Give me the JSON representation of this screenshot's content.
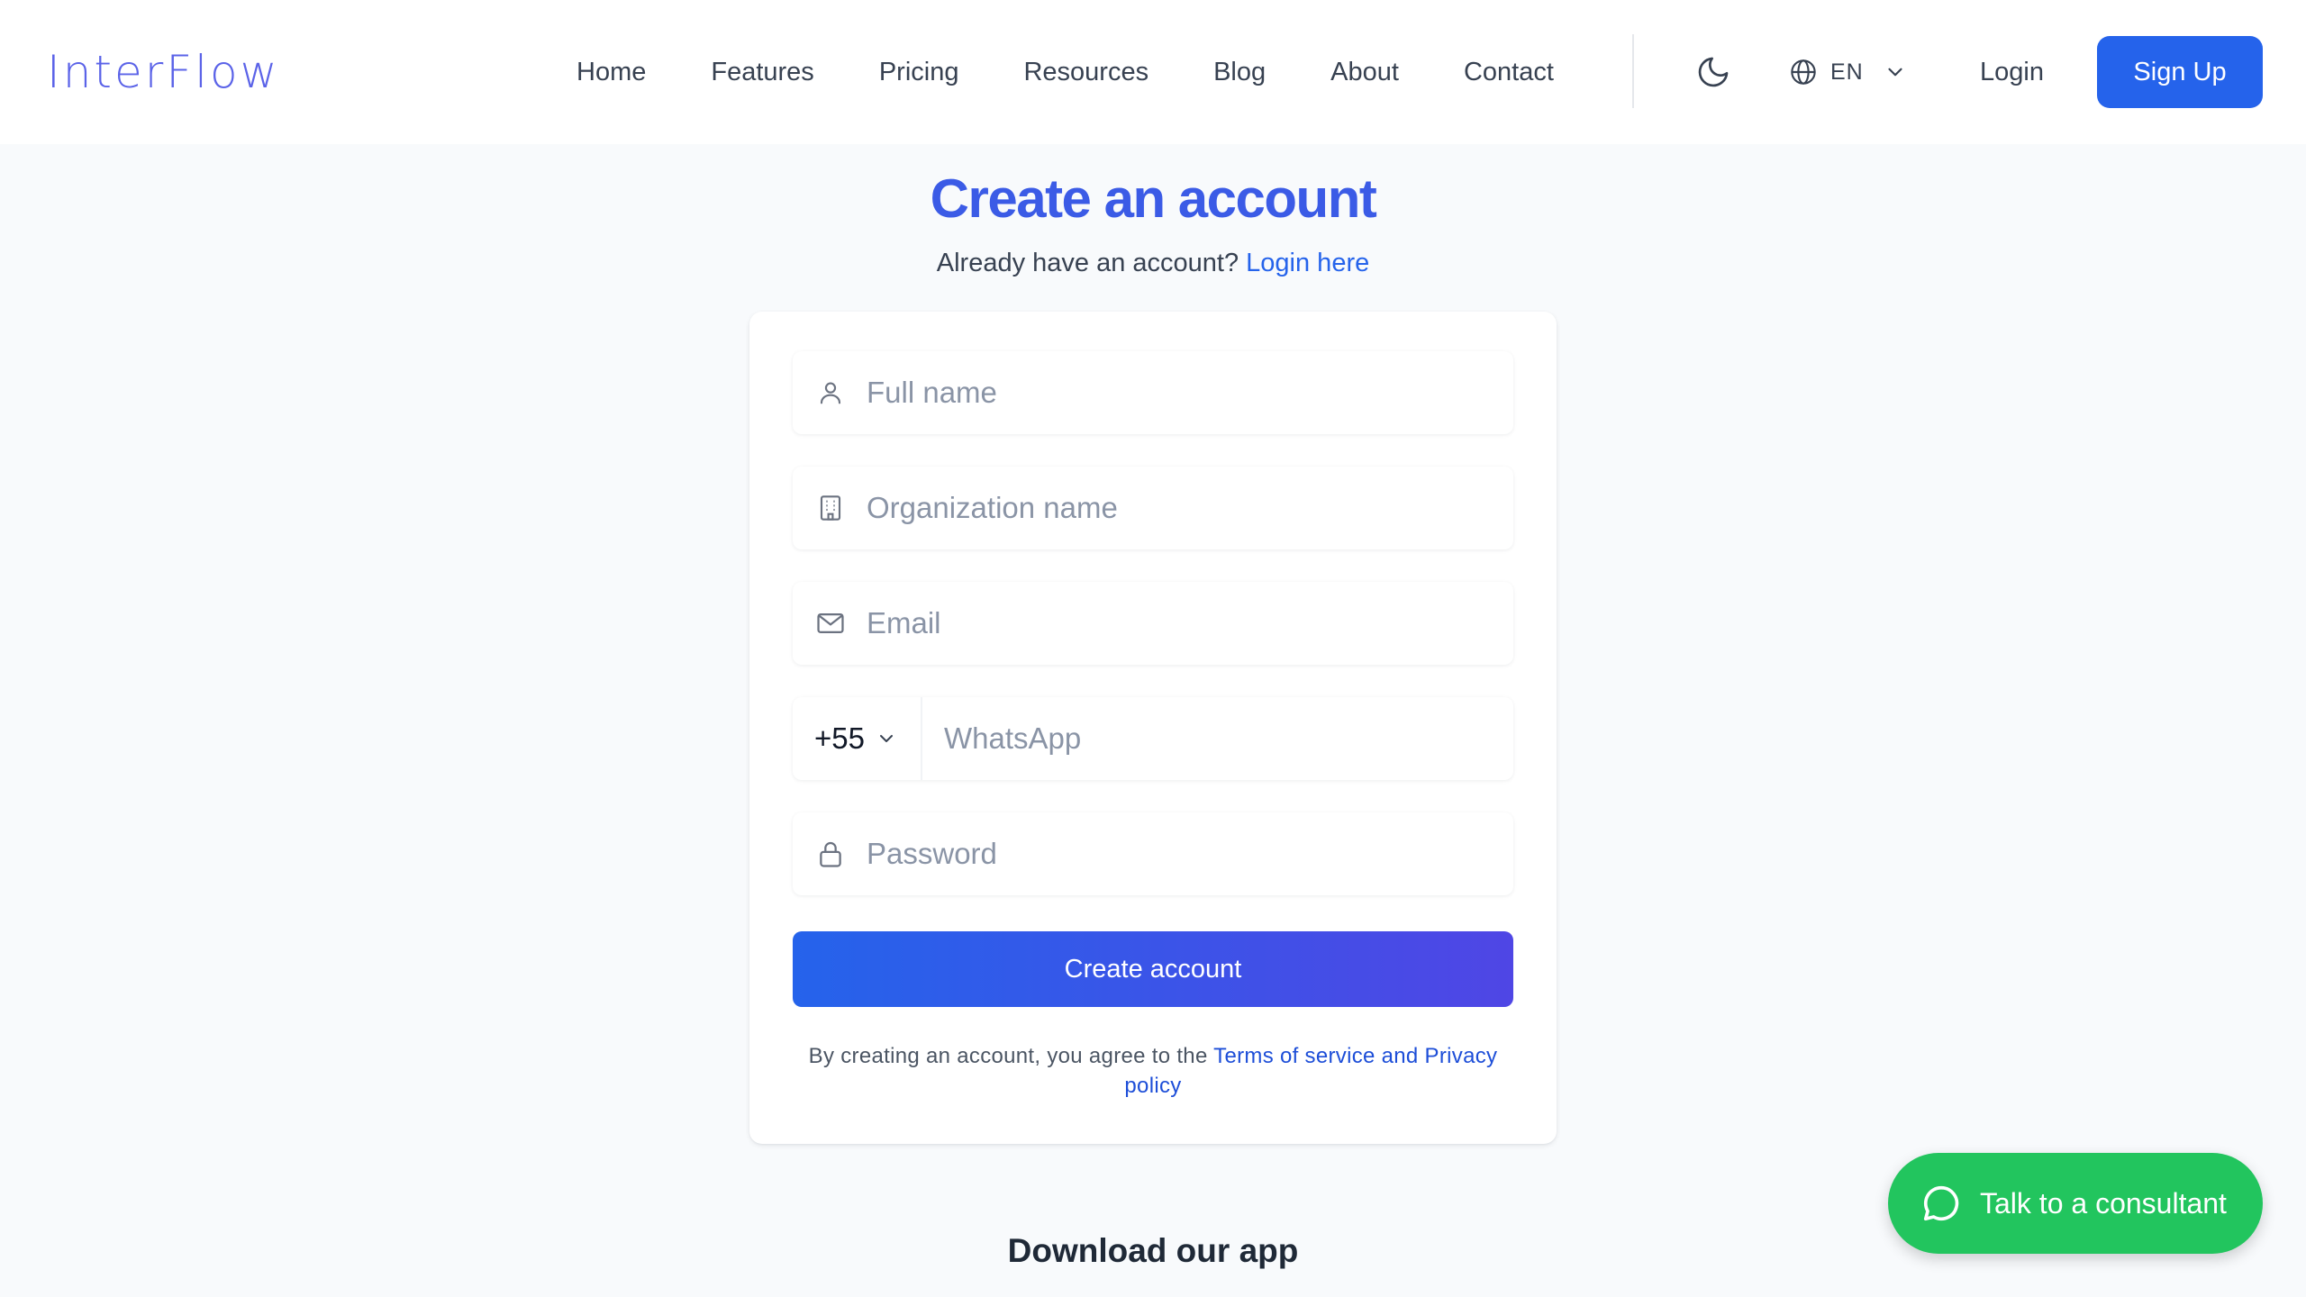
{
  "header": {
    "logo_text": "InterFlow",
    "nav": [
      "Home",
      "Features",
      "Pricing",
      "Resources",
      "Blog",
      "About",
      "Contact"
    ],
    "language": "EN",
    "login_label": "Login",
    "signup_label": "Sign Up"
  },
  "page": {
    "title": "Create an account",
    "subtitle_prefix": "Already have an account?",
    "subtitle_link": "Login here"
  },
  "form": {
    "full_name_placeholder": "Full name",
    "organization_placeholder": "Organization name",
    "email_placeholder": "Email",
    "country_code": "+55",
    "whatsapp_placeholder": "WhatsApp",
    "password_placeholder": "Password",
    "submit_label": "Create account",
    "terms_prefix": "By creating an account, you agree to the",
    "terms_link": "Terms of service and Privacy policy"
  },
  "download_title": "Download our app",
  "consultant_label": "Talk to a consultant",
  "icons": {
    "theme": "moon-icon",
    "language": "globe-icon",
    "full_name": "user-icon",
    "organization": "building-icon",
    "email": "mail-icon",
    "password": "lock-icon",
    "consultant": "chat-bubble-icon"
  },
  "colors": {
    "brand": "#5b63e8",
    "primary": "#2563eb",
    "title": "#3b5be6",
    "consultant": "#22c55e"
  }
}
